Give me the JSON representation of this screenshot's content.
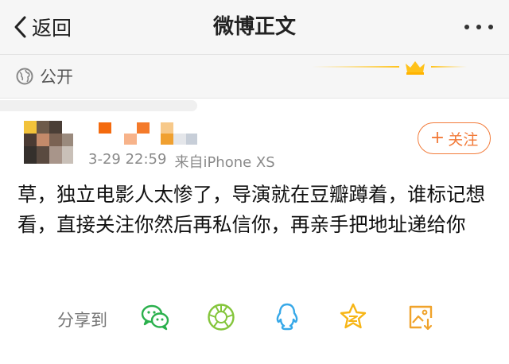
{
  "header": {
    "back_label": "返回",
    "title": "微博正文"
  },
  "visibility": {
    "label": "公开",
    "icon": "globe-icon"
  },
  "post": {
    "time": "3-29 22:59",
    "source": "来自iPhone XS",
    "text": "草，独立电影人太惨了，导演就在豆瓣蹲着，谁标记想看，直接关注你然后再私信你，再亲手把地址递给你",
    "follow_label": "关注"
  },
  "share": {
    "label": "分享到",
    "targets": [
      "wechat-icon",
      "moments-icon",
      "qq-icon",
      "qzone-icon",
      "save-image-icon"
    ]
  },
  "colors": {
    "accent": "#f27b3a",
    "header_bg": "#f6f6f6",
    "wechat": "#2ab04c",
    "moments": "#83c53a",
    "qq": "#36a8e8",
    "qzone": "#f7b515",
    "save": "#f0a32b"
  }
}
